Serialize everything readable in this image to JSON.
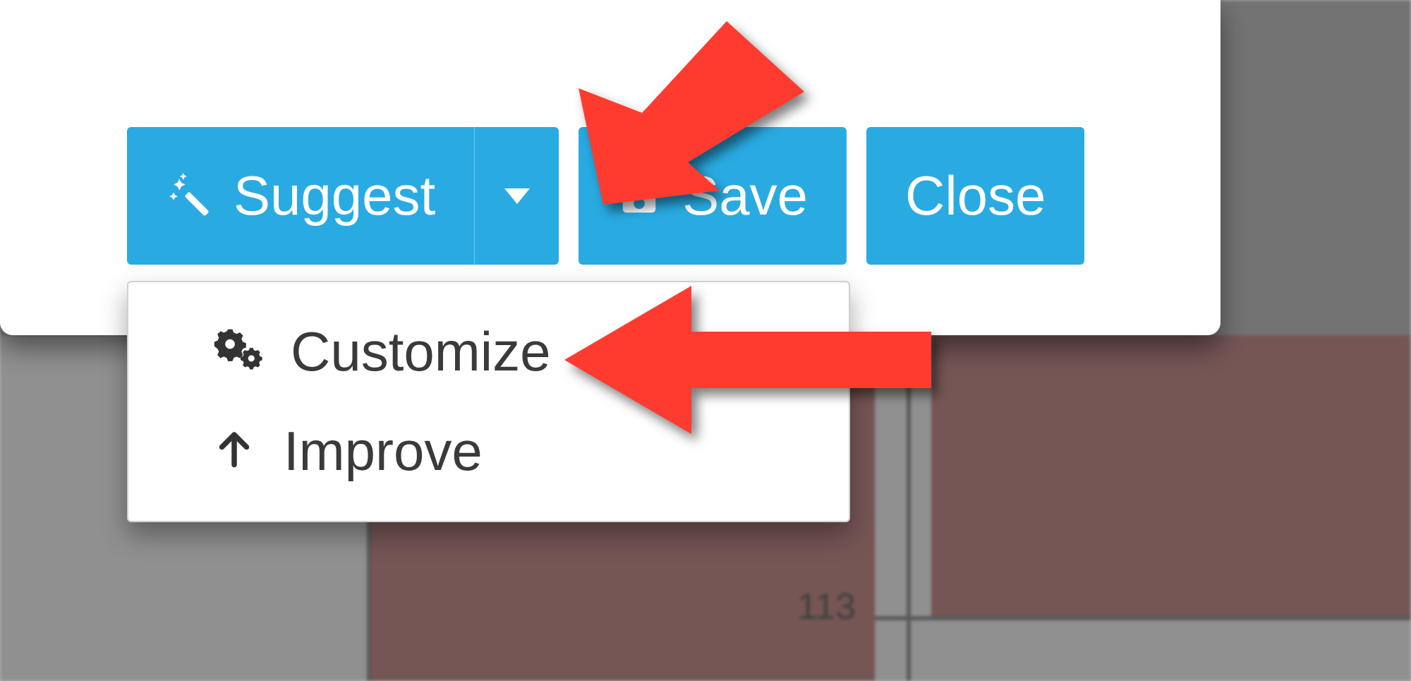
{
  "toolbar": {
    "suggest_label": "Suggest",
    "save_label": "Save",
    "close_label": "Close"
  },
  "dropdown": {
    "customize_label": "Customize",
    "improve_label": "Improve"
  },
  "background": {
    "tick_value": "113"
  },
  "colors": {
    "primary": "#29abe2",
    "annotation": "#ff3b30"
  }
}
